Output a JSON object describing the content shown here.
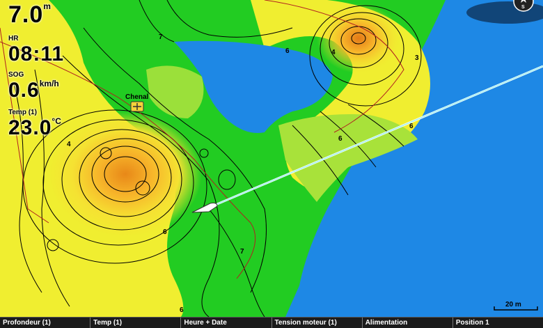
{
  "readouts": {
    "depth": {
      "value": "7.0",
      "unit": "m"
    },
    "time": {
      "label": "HR",
      "value": "08:11"
    },
    "sog": {
      "label": "SOG",
      "value": "0.6",
      "unit": "km/h"
    },
    "temp": {
      "label": "Temp (1)",
      "value": "23.0",
      "unit": "°C"
    }
  },
  "map": {
    "waypoint_label": "Chenal",
    "contour_labels": [
      "7",
      "6",
      "3",
      "4",
      "6",
      "4",
      "6",
      "7",
      "6",
      "6"
    ],
    "scale_label": "20 m",
    "compass_label": "S",
    "colors": {
      "deep_water": "#1e88e5",
      "shallow_green": "#22cc22",
      "light_green": "#9be03a",
      "yellow": "#f0ee30",
      "orange": "#f59a1a",
      "heading_line": "#9ff0f0"
    }
  },
  "bottom_bar": [
    "Profondeur (1)",
    "Temp (1)",
    "Heure + Date",
    "Tension moteur (1)",
    "Alimentation",
    "Position 1"
  ]
}
